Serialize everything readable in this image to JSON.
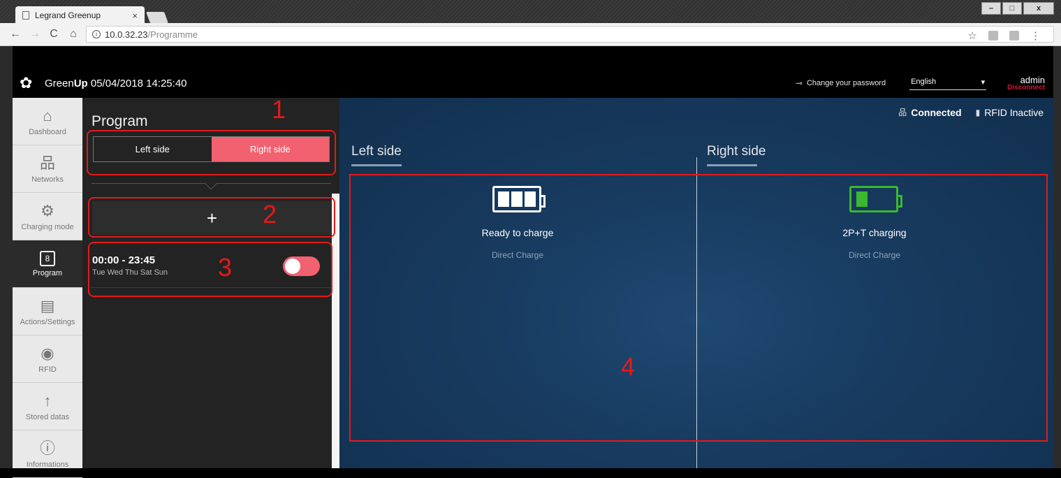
{
  "browser": {
    "tab_title": "Legrand Greenup",
    "tab_close": "×",
    "url_host": "10.0.32.23",
    "url_path": "/Programme",
    "back": "←",
    "forward": "→",
    "reload": "C",
    "home": "⌂",
    "star": "☆",
    "menu": "⋮",
    "win_min": "–",
    "win_max": "□",
    "win_close": "x"
  },
  "header": {
    "brand_prefix": "Green",
    "brand_bold": "Up",
    "datetime": "05/04/2018 14:25:40",
    "change_password": "Change your password",
    "language": "English",
    "user": "admin",
    "disconnect": "Disconnect"
  },
  "nav": {
    "dashboard": "Dashboard",
    "networks": "Networks",
    "charging_mode": "Charging mode",
    "program": "Program",
    "program_icon_text": "8",
    "actions": "Actions/Settings",
    "rfid": "RFID",
    "stored": "Stored datas",
    "info": "Informations"
  },
  "program": {
    "title": "Program",
    "left_side": "Left side",
    "right_side": "Right side",
    "add": "+",
    "item_time": "00:00 - 23:45",
    "item_days": "Tue Wed Thu Sat Sun",
    "item_enabled": true
  },
  "main": {
    "connected": "Connected",
    "rfid_status": "RFID Inactive",
    "left_title": "Left side",
    "right_title": "Right side",
    "left_status": "Ready to charge",
    "left_mode": "Direct Charge",
    "right_status": "2P+T charging",
    "right_mode": "Direct Charge"
  },
  "annotations": {
    "n1": "1",
    "n2": "2",
    "n3": "3",
    "n4": "4"
  },
  "colors": {
    "accent": "#f2616f",
    "battery_green": "#3ab82f",
    "annotation_red": "#e31a1a",
    "disconnect_red": "#e0112a"
  }
}
